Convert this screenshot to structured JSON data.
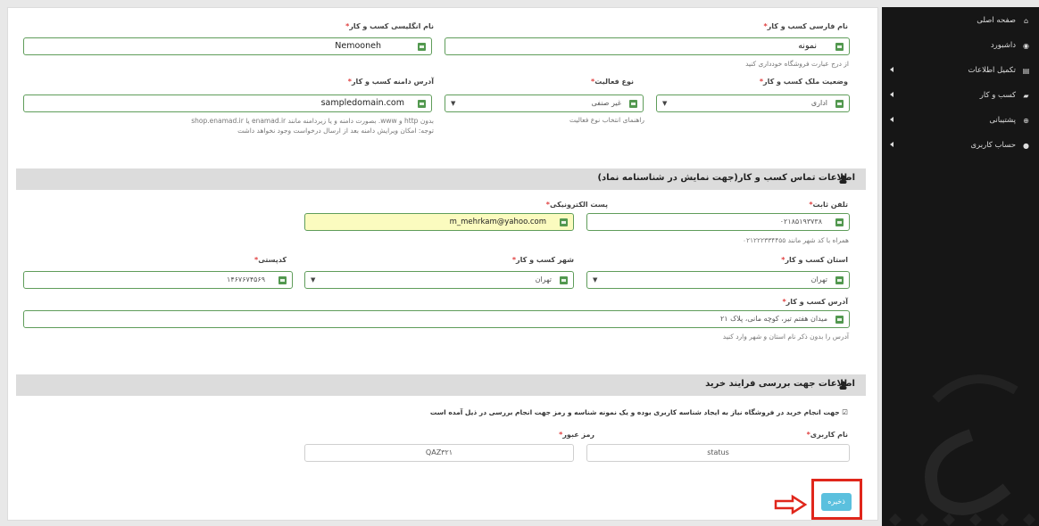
{
  "sidebar": {
    "items": [
      {
        "label": "صفحه اصلی",
        "icon": "home-icon",
        "has_arrow": false
      },
      {
        "label": "داشبورد",
        "icon": "dashboard-icon",
        "has_arrow": false
      },
      {
        "label": "تکمیل اطلاعات",
        "icon": "form-icon",
        "has_arrow": true
      },
      {
        "label": "کسب و کار",
        "icon": "folder-icon",
        "has_arrow": true
      },
      {
        "label": "پشتیبانی",
        "icon": "lifebuoy-icon",
        "has_arrow": true
      },
      {
        "label": "حساب کاربری",
        "icon": "user-icon",
        "has_arrow": true
      }
    ]
  },
  "business": {
    "persian_name": {
      "label": "نام فارسی کسب و کار",
      "required": "*",
      "value": "نمونه",
      "help": "از درج عبارت فروشگاه خودداری کنید"
    },
    "english_name": {
      "label": "نام انگلیسی کسب و کار",
      "required": "*",
      "value": "Nemooneh"
    },
    "ownership": {
      "label": "وضعیت ملک کسب و کار",
      "required": "*",
      "value": "اداری"
    },
    "activity_type": {
      "label": "نوع فعالیت",
      "required": "*",
      "value": "غیر صنفی",
      "help": "راهنمای انتخاب نوع فعالیت"
    },
    "domain": {
      "label": "آدرس دامنه کسب و کار",
      "required": "*",
      "value": "sampledomain.com",
      "help_line1": "بدون http و www. بصورت دامنه و یا زیردامنه مانند enamad.ir یا shop.enamad.ir",
      "help_line2": "توجه: امکان ویرایش دامنه بعد از ارسال درخواست وجود نخواهد داشت"
    }
  },
  "contact_section": {
    "title": "اطلاعات تماس کسب و کار(جهت نمایش در شناسنامه نماد)",
    "phone": {
      "label": "تلفن ثابت",
      "required": "*",
      "value": "۰۲۱۸۵۱۹۳۷۳۸",
      "help": "همراه با کد شهر مانند ۰۲۱۲۲۲۳۳۴۴۵۵"
    },
    "email": {
      "label": "پست الکترونیکی",
      "required": "*",
      "value": "m_mehrkam@yahoo.com"
    },
    "province": {
      "label": "استان کسب و کار",
      "required": "*",
      "value": "تهران"
    },
    "city": {
      "label": "شهر کسب و کار",
      "required": "*",
      "value": "تهران"
    },
    "postal_code": {
      "label": "کدپستی",
      "required": "*",
      "value": "۱۴۶۷۶۷۴۵۶۹"
    },
    "address": {
      "label": "آدرس کسب و کار",
      "required": "*",
      "value": "میدان هفتم تیر، کوچه مانی، پلاک ۲۱",
      "help": "آدرس را بدون ذکر نام استان و شهر وارد کنید"
    }
  },
  "purchase_section": {
    "title": "اطلاعات جهت بررسی فرایند خرید",
    "note": "جهت انجام خرید در فروشگاه نیاز به ایجاد شناسه کاربری بوده و یک نمونه شناسه و رمز جهت انجام بررسی در ذیل آمده است",
    "username": {
      "label": "نام کاربری",
      "required": "*",
      "value": "status"
    },
    "password": {
      "label": "رمز عبور",
      "required": "*",
      "value": "QAZ۳۲۱"
    }
  },
  "actions": {
    "save_label": "ذخیره"
  },
  "colors": {
    "valid_border": "#5f9d5a",
    "valid_check": "#52984f",
    "required_star": "#e04040",
    "save_button": "#5bc0de",
    "highlight": "#e0261b",
    "sidebar_bg": "#161616",
    "section_bg": "#dcdcdc"
  }
}
